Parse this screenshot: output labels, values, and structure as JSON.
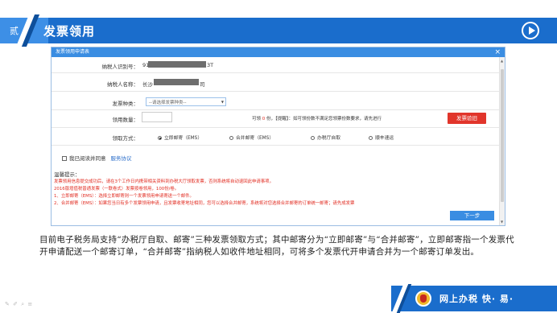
{
  "header": {
    "section_number": "贰",
    "title": "发票领用"
  },
  "dialog": {
    "title": "发票领用申请表",
    "close_label": "×",
    "fields": {
      "taxpayer_id_label": "纳税人识别号：",
      "taxpayer_id_prefix": "91",
      "taxpayer_id_suffix": "3T",
      "taxpayer_name_label": "纳税人名称：",
      "taxpayer_name_prefix": "长沙",
      "taxpayer_name_suffix": "司",
      "invoice_type_label": "发票种类：",
      "invoice_type_placeholder": "--请选择发票种类--",
      "quantity_label": "领用数量：",
      "delivery_label": "领取方式："
    },
    "hint": {
      "prefix": "可领",
      "count": "0",
      "suffix": "份，【提醒】：如可领份数不满足您领票份数要求，请先进行"
    },
    "apply_button": "发票验旧",
    "delivery_options": [
      {
        "label": "立即邮寄（EMS）",
        "selected": true
      },
      {
        "label": "合并邮寄（EMS）",
        "selected": false
      },
      {
        "label": "办税厅自取",
        "selected": false
      },
      {
        "label": "顺丰速运",
        "selected": false
      }
    ],
    "agree_label": "我已阅读并同意",
    "agreement_link": "服务协议",
    "tips_title": "温馨提示：",
    "tips": [
      "发票领用信息提交成功后，请在3个工作日内携带相关资料到办税大厅领取发票，否则系统将自动退回此申请事项。",
      "2016版增值税普通发票（一联卷式）发票按卷领用，100份/卷。",
      "1、立即邮寄（EMS）：选择立即邮寄则一个发票领用申请寄送一个邮件。",
      "2、合并邮寄（EMS）：如果您当日有多个发票领用申请，且发票收寄地址相同，您可以选择合并邮寄，系统将对您选择合并邮寄的订单统一邮寄；请先成发票"
    ],
    "next_button": "下一步"
  },
  "paragraph": "目前电子税务局支持“办税厅自取、邮寄”三种发票领取方式；其中邮寄分为“立即邮寄”与“合并邮寄”，立即邮寄指一个发票代开申请配送一个邮寄订单，“合并邮寄”指纳税人如收件地址相同，可将多个发票代开申请合并为一个邮寄订单发出。",
  "footer": {
    "slogan": "网上办税 快· 易·"
  },
  "colors": {
    "brand_blue": "#1a6dcc",
    "dialog_blue": "#3a8de2",
    "alert_red": "#e12b20"
  }
}
